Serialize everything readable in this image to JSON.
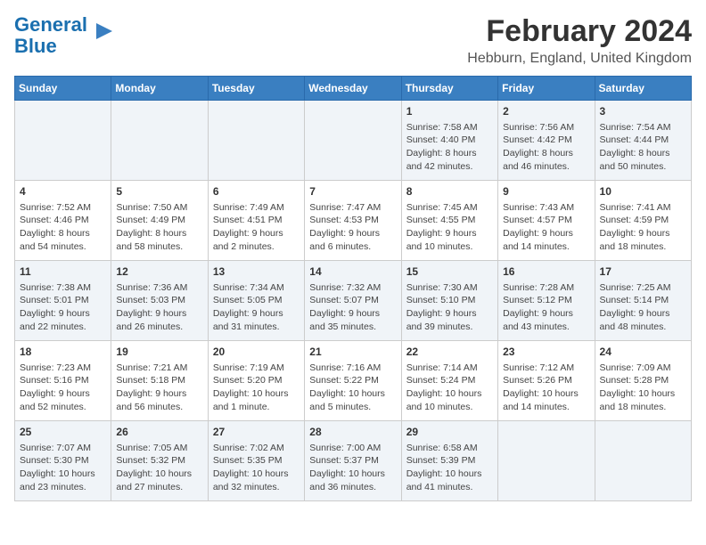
{
  "logo": {
    "line1": "General",
    "line2": "Blue"
  },
  "title": "February 2024",
  "subtitle": "Hebburn, England, United Kingdom",
  "days_of_week": [
    "Sunday",
    "Monday",
    "Tuesday",
    "Wednesday",
    "Thursday",
    "Friday",
    "Saturday"
  ],
  "weeks": [
    [
      {
        "day": "",
        "content": ""
      },
      {
        "day": "",
        "content": ""
      },
      {
        "day": "",
        "content": ""
      },
      {
        "day": "",
        "content": ""
      },
      {
        "day": "1",
        "content": "Sunrise: 7:58 AM\nSunset: 4:40 PM\nDaylight: 8 hours\nand 42 minutes."
      },
      {
        "day": "2",
        "content": "Sunrise: 7:56 AM\nSunset: 4:42 PM\nDaylight: 8 hours\nand 46 minutes."
      },
      {
        "day": "3",
        "content": "Sunrise: 7:54 AM\nSunset: 4:44 PM\nDaylight: 8 hours\nand 50 minutes."
      }
    ],
    [
      {
        "day": "4",
        "content": "Sunrise: 7:52 AM\nSunset: 4:46 PM\nDaylight: 8 hours\nand 54 minutes."
      },
      {
        "day": "5",
        "content": "Sunrise: 7:50 AM\nSunset: 4:49 PM\nDaylight: 8 hours\nand 58 minutes."
      },
      {
        "day": "6",
        "content": "Sunrise: 7:49 AM\nSunset: 4:51 PM\nDaylight: 9 hours\nand 2 minutes."
      },
      {
        "day": "7",
        "content": "Sunrise: 7:47 AM\nSunset: 4:53 PM\nDaylight: 9 hours\nand 6 minutes."
      },
      {
        "day": "8",
        "content": "Sunrise: 7:45 AM\nSunset: 4:55 PM\nDaylight: 9 hours\nand 10 minutes."
      },
      {
        "day": "9",
        "content": "Sunrise: 7:43 AM\nSunset: 4:57 PM\nDaylight: 9 hours\nand 14 minutes."
      },
      {
        "day": "10",
        "content": "Sunrise: 7:41 AM\nSunset: 4:59 PM\nDaylight: 9 hours\nand 18 minutes."
      }
    ],
    [
      {
        "day": "11",
        "content": "Sunrise: 7:38 AM\nSunset: 5:01 PM\nDaylight: 9 hours\nand 22 minutes."
      },
      {
        "day": "12",
        "content": "Sunrise: 7:36 AM\nSunset: 5:03 PM\nDaylight: 9 hours\nand 26 minutes."
      },
      {
        "day": "13",
        "content": "Sunrise: 7:34 AM\nSunset: 5:05 PM\nDaylight: 9 hours\nand 31 minutes."
      },
      {
        "day": "14",
        "content": "Sunrise: 7:32 AM\nSunset: 5:07 PM\nDaylight: 9 hours\nand 35 minutes."
      },
      {
        "day": "15",
        "content": "Sunrise: 7:30 AM\nSunset: 5:10 PM\nDaylight: 9 hours\nand 39 minutes."
      },
      {
        "day": "16",
        "content": "Sunrise: 7:28 AM\nSunset: 5:12 PM\nDaylight: 9 hours\nand 43 minutes."
      },
      {
        "day": "17",
        "content": "Sunrise: 7:25 AM\nSunset: 5:14 PM\nDaylight: 9 hours\nand 48 minutes."
      }
    ],
    [
      {
        "day": "18",
        "content": "Sunrise: 7:23 AM\nSunset: 5:16 PM\nDaylight: 9 hours\nand 52 minutes."
      },
      {
        "day": "19",
        "content": "Sunrise: 7:21 AM\nSunset: 5:18 PM\nDaylight: 9 hours\nand 56 minutes."
      },
      {
        "day": "20",
        "content": "Sunrise: 7:19 AM\nSunset: 5:20 PM\nDaylight: 10 hours\nand 1 minute."
      },
      {
        "day": "21",
        "content": "Sunrise: 7:16 AM\nSunset: 5:22 PM\nDaylight: 10 hours\nand 5 minutes."
      },
      {
        "day": "22",
        "content": "Sunrise: 7:14 AM\nSunset: 5:24 PM\nDaylight: 10 hours\nand 10 minutes."
      },
      {
        "day": "23",
        "content": "Sunrise: 7:12 AM\nSunset: 5:26 PM\nDaylight: 10 hours\nand 14 minutes."
      },
      {
        "day": "24",
        "content": "Sunrise: 7:09 AM\nSunset: 5:28 PM\nDaylight: 10 hours\nand 18 minutes."
      }
    ],
    [
      {
        "day": "25",
        "content": "Sunrise: 7:07 AM\nSunset: 5:30 PM\nDaylight: 10 hours\nand 23 minutes."
      },
      {
        "day": "26",
        "content": "Sunrise: 7:05 AM\nSunset: 5:32 PM\nDaylight: 10 hours\nand 27 minutes."
      },
      {
        "day": "27",
        "content": "Sunrise: 7:02 AM\nSunset: 5:35 PM\nDaylight: 10 hours\nand 32 minutes."
      },
      {
        "day": "28",
        "content": "Sunrise: 7:00 AM\nSunset: 5:37 PM\nDaylight: 10 hours\nand 36 minutes."
      },
      {
        "day": "29",
        "content": "Sunrise: 6:58 AM\nSunset: 5:39 PM\nDaylight: 10 hours\nand 41 minutes."
      },
      {
        "day": "",
        "content": ""
      },
      {
        "day": "",
        "content": ""
      }
    ]
  ]
}
